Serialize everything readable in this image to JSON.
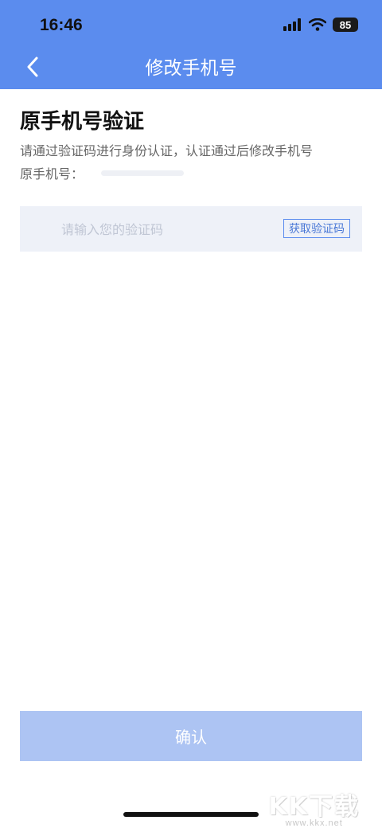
{
  "status_bar": {
    "time": "16:46",
    "battery": "85"
  },
  "nav": {
    "title": "修改手机号"
  },
  "main": {
    "title": "原手机号验证",
    "subtitle": "请通过验证码进行身份认证，认证通过后修改手机号",
    "original_phone_label": "原手机号："
  },
  "code_field": {
    "placeholder": "请输入您的验证码",
    "get_code_label": "获取验证码"
  },
  "confirm_label": "确认",
  "watermark": {
    "logo": "KK下载",
    "url": "www.kkx.net"
  },
  "colors": {
    "accent": "#5b8cee",
    "confirm_disabled": "#adc4f3",
    "input_bg": "#eef1f8"
  }
}
